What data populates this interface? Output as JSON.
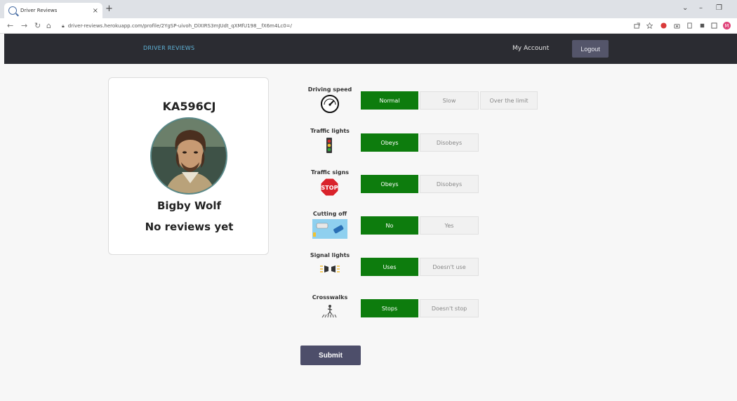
{
  "browser": {
    "tab_title": "Driver Reviews",
    "tab_close": "×",
    "new_tab": "+",
    "url": "driver-reviews.herokuapp.com/profile/2YgSP-uivoh_DlXIRS3mJUdt_qXMfU198__fX6m4Lc0=/"
  },
  "header": {
    "brand": "DRIVER REVIEWS",
    "account": "My Account",
    "logout": "Logout"
  },
  "profile": {
    "plate": "KA596CJ",
    "name": "Bigby Wolf",
    "reviews": "No reviews yet"
  },
  "criteria": [
    {
      "label": "Driving speed",
      "icon": "speedometer-icon",
      "options": [
        "Normal",
        "Slow",
        "Over the limit"
      ],
      "selected": "Normal"
    },
    {
      "label": "Traffic lights",
      "icon": "traffic-light-icon",
      "options": [
        "Obeys",
        "Disobeys"
      ],
      "selected": "Obeys"
    },
    {
      "label": "Traffic signs",
      "icon": "stop-sign-icon",
      "options": [
        "Obeys",
        "Disobeys"
      ],
      "selected": "Obeys"
    },
    {
      "label": "Cutting off",
      "icon": "cars-icon",
      "options": [
        "No",
        "Yes"
      ],
      "selected": "No"
    },
    {
      "label": "Signal lights",
      "icon": "signal-light-icon",
      "options": [
        "Uses",
        "Doesn't use"
      ],
      "selected": "Uses"
    },
    {
      "label": "Crosswalks",
      "icon": "crosswalk-icon",
      "options": [
        "Stops",
        "Doesn't stop"
      ],
      "selected": "Stops"
    }
  ],
  "submit": "Submit",
  "colors": {
    "selected": "#0d7c0d",
    "header_bg": "#2b2c32",
    "brand": "#5fb4d9",
    "button": "#4d4e6a"
  }
}
